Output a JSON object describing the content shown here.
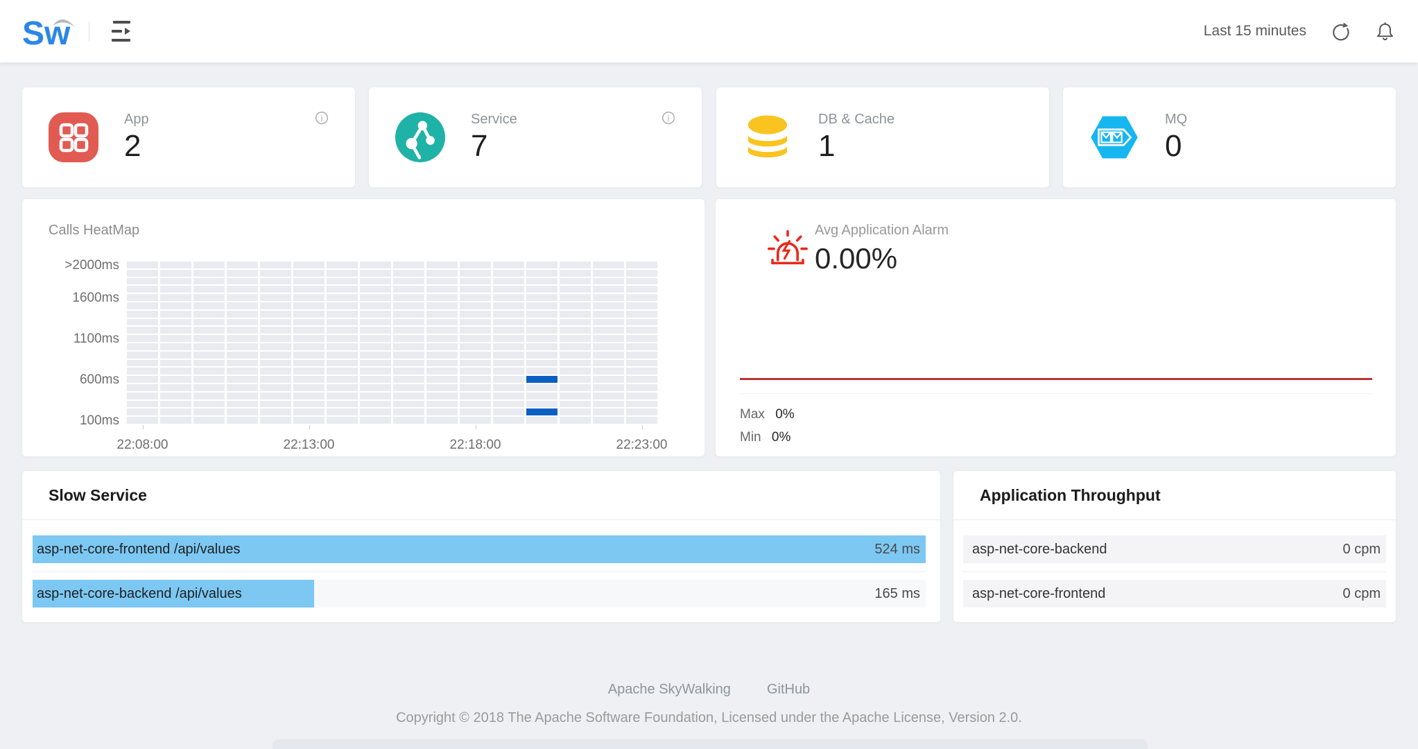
{
  "header": {
    "logo_text": "Sw",
    "time_range_label": "Last 15 minutes"
  },
  "stat_cards": [
    {
      "label": "App",
      "value": "2",
      "icon": "app-grid-icon",
      "icon_color": "#e15b52",
      "has_info": true
    },
    {
      "label": "Service",
      "value": "7",
      "icon": "service-topology-icon",
      "icon_color": "#1fb2a6",
      "has_info": true
    },
    {
      "label": "DB & Cache",
      "value": "1",
      "icon": "database-icon",
      "icon_color": "#f9c320",
      "has_info": false
    },
    {
      "label": "MQ",
      "value": "0",
      "icon": "mq-hexagon-icon",
      "icon_color": "#16b6f0",
      "has_info": false
    }
  ],
  "chart_data": {
    "type": "heatmap",
    "title": "Calls HeatMap",
    "rows": 20,
    "cols": 16,
    "cell_color": "#e9ebf0",
    "highlight_color": "#0c5fc2",
    "y_labels": [
      {
        "text": ">2000ms",
        "row": 0
      },
      {
        "text": "1600ms",
        "row": 4
      },
      {
        "text": "1100ms",
        "row": 9
      },
      {
        "text": "600ms",
        "row": 14
      },
      {
        "text": "100ms",
        "row": 19
      }
    ],
    "x_labels": [
      {
        "text": "22:08:00",
        "col": 0
      },
      {
        "text": "22:13:00",
        "col": 5
      },
      {
        "text": "22:18:00",
        "col": 10
      },
      {
        "text": "22:23:00",
        "col": 15
      }
    ],
    "highlight_cells": [
      {
        "col": 12,
        "row": 14,
        "time": "22:20:00",
        "bucket": "600ms"
      },
      {
        "col": 12,
        "row": 18,
        "time": "22:20:00",
        "bucket": "200ms"
      }
    ]
  },
  "alarm": {
    "title": "Avg Application Alarm",
    "value": "0.00%",
    "max_label": "Max",
    "max_value": "0%",
    "min_label": "Min",
    "min_value": "0%",
    "line_color": "#b93531"
  },
  "slow_service": {
    "title": "Slow Service",
    "unit": "ms",
    "bar_color": "#7cc8f3",
    "max_value": 524,
    "items": [
      {
        "name": "asp-net-core-frontend /api/values",
        "value": 524,
        "value_text": "524 ms"
      },
      {
        "name": "asp-net-core-backend /api/values",
        "value": 165,
        "value_text": "165 ms"
      }
    ]
  },
  "throughput": {
    "title": "Application Throughput",
    "unit": "cpm",
    "max_value": 1,
    "items": [
      {
        "name": "asp-net-core-backend",
        "value": 0,
        "value_text": "0 cpm"
      },
      {
        "name": "asp-net-core-frontend",
        "value": 0,
        "value_text": "0 cpm"
      }
    ]
  },
  "footer": {
    "links": [
      "Apache SkyWalking",
      "GitHub"
    ],
    "copyright": "Copyright © 2018 The Apache Software Foundation, Licensed under the Apache License, Version 2.0."
  }
}
